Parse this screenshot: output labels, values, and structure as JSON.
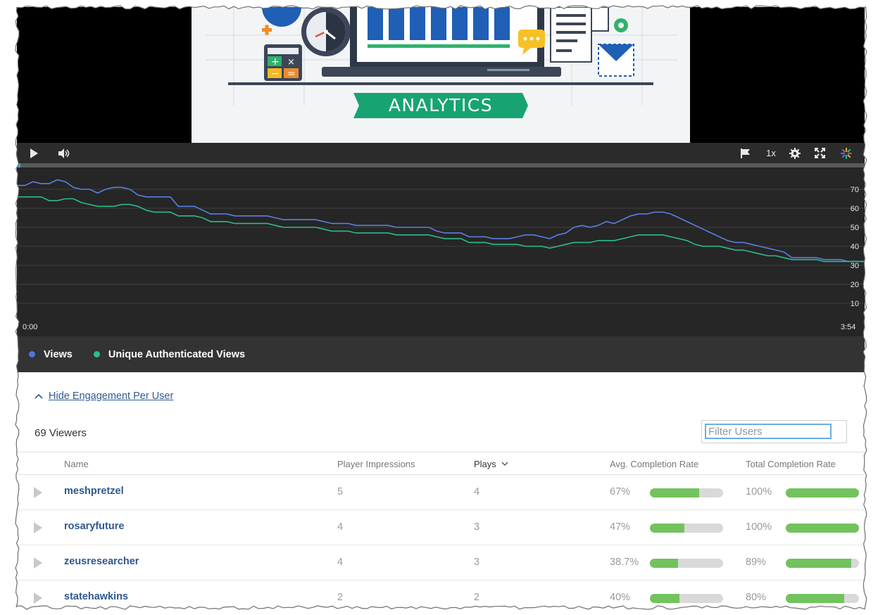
{
  "video": {
    "thumbnail_text": "ANALYTICS",
    "playback_rate": "1x"
  },
  "controls": {
    "icons": [
      "play-icon",
      "volume-icon",
      "flag-icon",
      "settings-gear-icon",
      "fullscreen-icon",
      "kaltura-logo-icon"
    ],
    "progress": 0.004
  },
  "chart_data": {
    "type": "line",
    "x_start_label": "0:00",
    "x_end_label": "3:54",
    "y_ticks": [
      10,
      20,
      30,
      40,
      50,
      60,
      70
    ],
    "ylim": [
      0,
      80
    ],
    "series": [
      {
        "name": "Views",
        "color": "#5b7fe3",
        "values": [
          72,
          72,
          74,
          73,
          73,
          75,
          74,
          71,
          70,
          70,
          68,
          70,
          71,
          71,
          70,
          67,
          66,
          66,
          66,
          66,
          61,
          61,
          61,
          59,
          57,
          57,
          57,
          56,
          56,
          56,
          56,
          56,
          55,
          54,
          54,
          54,
          54,
          54,
          53,
          52,
          52,
          52,
          51,
          51,
          51,
          51,
          51,
          50,
          50,
          50,
          50,
          50,
          48,
          47,
          47,
          47,
          45,
          45,
          45,
          44,
          44,
          44,
          45,
          46,
          46,
          45,
          44,
          46,
          47,
          50,
          51,
          50,
          51,
          53,
          52,
          54,
          56,
          57,
          57,
          58,
          58,
          57,
          55,
          53,
          51,
          49,
          47,
          45,
          43,
          42,
          42,
          41,
          40,
          39,
          38,
          37,
          34,
          34,
          34,
          34,
          33,
          33,
          33,
          32,
          32,
          32
        ]
      },
      {
        "name": "Unique Authenticated Views",
        "color": "#2cbc8d",
        "values": [
          66,
          66,
          66,
          66,
          64,
          64,
          65,
          65,
          63,
          62,
          61,
          61,
          61,
          62,
          62,
          61,
          59,
          58,
          58,
          58,
          56,
          56,
          56,
          55,
          53,
          53,
          53,
          52,
          52,
          52,
          52,
          52,
          51,
          50,
          50,
          50,
          50,
          50,
          49,
          48,
          48,
          48,
          47,
          47,
          47,
          47,
          47,
          46,
          46,
          46,
          46,
          46,
          45,
          44,
          44,
          44,
          42,
          42,
          42,
          41,
          41,
          41,
          41,
          40,
          40,
          40,
          39,
          40,
          41,
          42,
          42,
          42,
          43,
          43,
          43,
          44,
          45,
          46,
          46,
          46,
          46,
          45,
          44,
          43,
          41,
          40,
          40,
          40,
          39,
          38,
          38,
          37,
          36,
          35,
          35,
          34,
          33,
          33,
          33,
          33,
          32,
          32,
          32,
          32,
          32,
          32
        ]
      }
    ],
    "grid": true,
    "legend": "bottom-left"
  },
  "legend": {
    "items": [
      {
        "label": "Views",
        "color": "#4f77d9"
      },
      {
        "label": "Unique Authenticated Views",
        "color": "#2cbc8d"
      }
    ]
  },
  "engagement": {
    "toggle_label": "Hide Engagement Per User",
    "viewers_count": "69 Viewers",
    "filter_placeholder": "Filter Users",
    "columns": {
      "name": "Name",
      "impressions": "Player Impressions",
      "plays": "Plays",
      "avg_completion": "Avg. Completion Rate",
      "total_completion": "Total Completion Rate"
    },
    "rows": [
      {
        "name": "meshpretzel",
        "impressions": "5",
        "plays": "4",
        "avg_completion": "67%",
        "avg_fraction": 0.67,
        "total_completion": "100%",
        "total_fraction": 1.0
      },
      {
        "name": "rosaryfuture",
        "impressions": "4",
        "plays": "3",
        "avg_completion": "47%",
        "avg_fraction": 0.47,
        "total_completion": "100%",
        "total_fraction": 1.0
      },
      {
        "name": "zeusresearcher",
        "impressions": "4",
        "plays": "3",
        "avg_completion": "38.7%",
        "avg_fraction": 0.387,
        "total_completion": "89%",
        "total_fraction": 0.89
      },
      {
        "name": "statehawkins",
        "impressions": "2",
        "plays": "2",
        "avg_completion": "40%",
        "avg_fraction": 0.4,
        "total_completion": "80%",
        "total_fraction": 0.8
      }
    ]
  }
}
